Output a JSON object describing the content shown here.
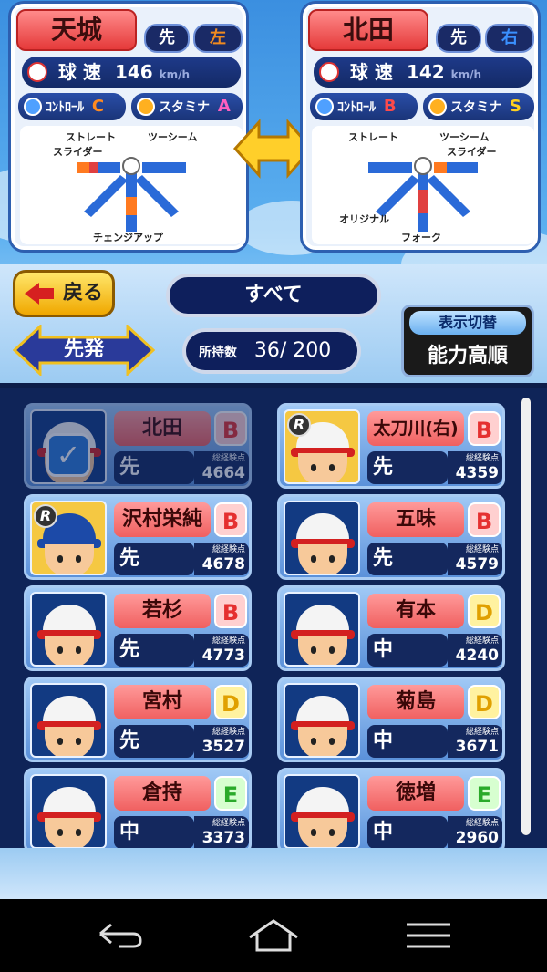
{
  "compare": {
    "left": {
      "name": "天城",
      "position": "先",
      "hand": "左",
      "speed_label": "球 速",
      "speed": "146",
      "speed_unit": "km/h",
      "control_label": "ｺﾝﾄﾛｰﾙ",
      "control_grade": "C",
      "stamina_label": "スタミナ",
      "stamina_grade": "A",
      "pitches": {
        "top_left": "ストレート",
        "top_right": "ツーシーム",
        "left": "スライダー",
        "bottom": "チェンジアップ"
      }
    },
    "right": {
      "name": "北田",
      "position": "先",
      "hand": "右",
      "speed_label": "球 速",
      "speed": "142",
      "speed_unit": "km/h",
      "control_label": "ｺﾝﾄﾛｰﾙ",
      "control_grade": "B",
      "stamina_label": "スタミナ",
      "stamina_grade": "S",
      "pitches": {
        "top_left": "ストレート",
        "top_right": "ツーシーム",
        "right": "スライダー",
        "bottom_left": "オリジナル",
        "bottom": "フォーク"
      }
    }
  },
  "controls": {
    "back_label": "戻る",
    "filter_label": "すべて",
    "order_label": "先発",
    "count_label": "所持数",
    "count_value": "36/ 200",
    "sort_toggle_label": "表示切替",
    "sort_label": "能力高順"
  },
  "players": [
    {
      "name": "北田",
      "rank": "B",
      "position": "先",
      "exp_label": "総経験点",
      "exp": "4664",
      "selected": true
    },
    {
      "name": "太刀川(右)",
      "rank": "B",
      "position": "先",
      "exp_label": "総経験点",
      "exp": "4359"
    },
    {
      "name": "沢村栄純",
      "rank": "B",
      "position": "先",
      "exp_label": "総経験点",
      "exp": "4678"
    },
    {
      "name": "五味",
      "rank": "B",
      "position": "先",
      "exp_label": "総経験点",
      "exp": "4579"
    },
    {
      "name": "若杉",
      "rank": "B",
      "position": "先",
      "exp_label": "総経験点",
      "exp": "4773"
    },
    {
      "name": "有本",
      "rank": "D",
      "position": "中",
      "exp_label": "総経験点",
      "exp": "4240"
    },
    {
      "name": "宮村",
      "rank": "D",
      "position": "先",
      "exp_label": "総経験点",
      "exp": "3527"
    },
    {
      "name": "菊島",
      "rank": "D",
      "position": "中",
      "exp_label": "総経験点",
      "exp": "3671"
    },
    {
      "name": "倉持",
      "rank": "E",
      "position": "中",
      "exp_label": "総経験点",
      "exp": "3373"
    },
    {
      "name": "徳増",
      "rank": "E",
      "position": "中",
      "exp_label": "総経験点",
      "exp": "2960"
    }
  ],
  "colors": {
    "hand_left": "#f08a20",
    "hand_right": "#3a90ff",
    "control_c": "#ff8a20",
    "control_b": "#ff4a4a",
    "stamina_a": "#ff60c0",
    "stamina_s": "#ffd020"
  },
  "icons": [
    "back-nav-icon",
    "home-nav-icon",
    "menu-nav-icon"
  ]
}
